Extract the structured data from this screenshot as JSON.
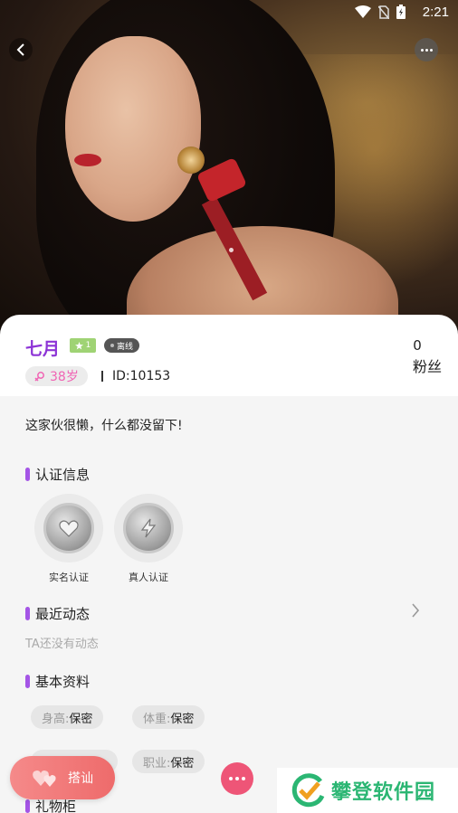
{
  "status_bar": {
    "time": "2:21"
  },
  "profile": {
    "name": "七月",
    "level": "1",
    "online_status": "离线",
    "age": "38岁",
    "user_id": "ID:10153",
    "fans_count": "0",
    "fans_label": "粉丝",
    "signature": "这家伙很懒，什么都没留下!"
  },
  "sections": {
    "verification": {
      "title": "认证信息",
      "items": [
        {
          "label": "实名认证"
        },
        {
          "label": "真人认证"
        }
      ]
    },
    "moments": {
      "title": "最近动态",
      "empty_text": "TA还没有动态"
    },
    "basic_info": {
      "title": "基本资料",
      "fields": [
        {
          "key": "身高:",
          "value": "保密"
        },
        {
          "key": "体重:",
          "value": "保密"
        },
        {
          "key": "职业:",
          "value": "保密"
        }
      ]
    },
    "gifts": {
      "title": "礼物柜"
    }
  },
  "actions": {
    "chat_label": "搭讪"
  },
  "watermark": {
    "text": "攀登软件园"
  },
  "colors": {
    "accent": "#8d34d6",
    "section_mark": "#a455e6",
    "chat_button": "#ee6b6b",
    "age_text": "#f064b4"
  }
}
